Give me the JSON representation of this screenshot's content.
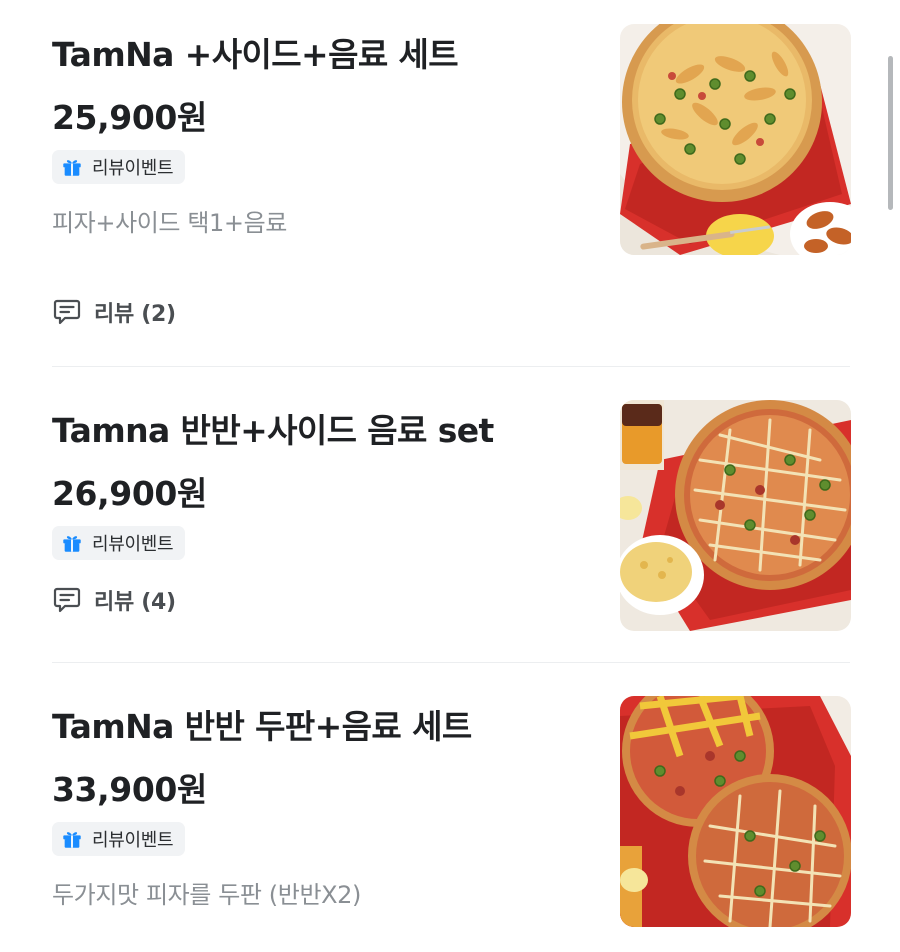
{
  "menu_items": [
    {
      "name": "TamNa +사이드+음료 세트",
      "price": "25,900원",
      "badge": "리뷰이벤트",
      "description": "피자+사이드 택1+음료",
      "review": "리뷰 (2)",
      "badge_icon": "gift-icon",
      "review_icon": "speech-bubble-icon",
      "image": "pizza-set-photo"
    },
    {
      "name": "Tamna 반반+사이드 음료 set",
      "price": "26,900원",
      "badge": "리뷰이벤트",
      "review": "리뷰 (4)",
      "badge_icon": "gift-icon",
      "review_icon": "speech-bubble-icon",
      "image": "half-half-pizza-photo"
    },
    {
      "name": "TamNa 반반 두판+음료 세트",
      "price": "33,900원",
      "badge": "리뷰이벤트",
      "description": "두가지맛 피자를 두판 (반반X2)",
      "badge_icon": "gift-icon",
      "image": "two-pizzas-photo"
    }
  ],
  "colors": {
    "badge_icon": "#1a8cff",
    "badge_bg": "#f1f3f5",
    "title_text": "#1f2124",
    "description_text": "#8a8f94",
    "divider": "#eceef0",
    "pizza_box_red": "#d8302b"
  }
}
